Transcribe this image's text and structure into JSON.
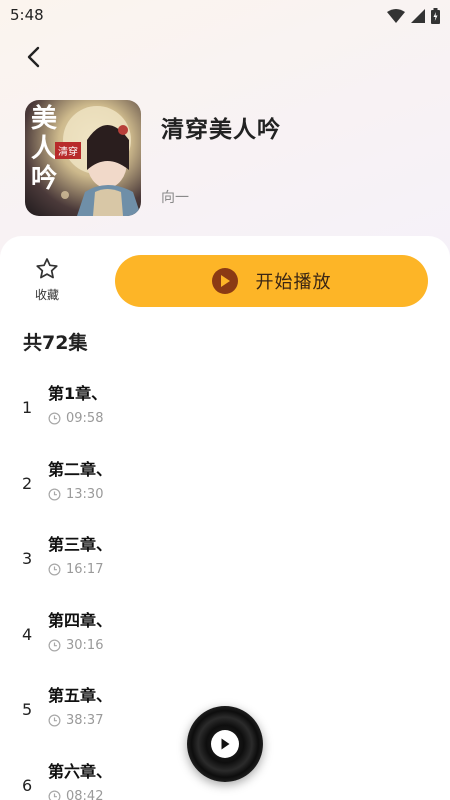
{
  "status_bar": {
    "time": "5:48",
    "icons": [
      "wifi-icon",
      "signal-icon",
      "battery-icon"
    ]
  },
  "header": {
    "back_icon": "back-arrow-icon",
    "title": "清穿美人吟",
    "author": "向一",
    "cover_text": [
      "美人吟",
      "清穿"
    ]
  },
  "actions": {
    "favorite_label": "收藏",
    "play_label": "开始播放",
    "accent_color": "#fdb527"
  },
  "episodes_header": "共72集",
  "episodes": [
    {
      "num": "1",
      "title": "第1章、",
      "duration": "09:58"
    },
    {
      "num": "2",
      "title": "第二章、",
      "duration": "13:30"
    },
    {
      "num": "3",
      "title": "第三章、",
      "duration": "16:17"
    },
    {
      "num": "4",
      "title": "第四章、",
      "duration": "30:16"
    },
    {
      "num": "5",
      "title": "第五章、",
      "duration": "38:37"
    },
    {
      "num": "6",
      "title": "第六章、",
      "duration": "08:42"
    }
  ],
  "mini_player": {
    "icon": "play-icon"
  }
}
